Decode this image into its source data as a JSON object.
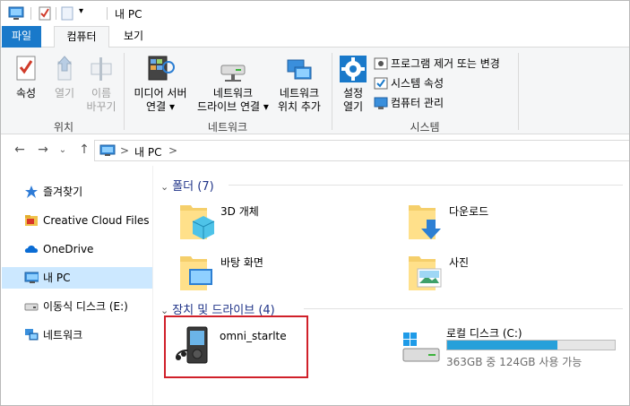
{
  "window": {
    "title": "내 PC"
  },
  "ribbon_tabs": [
    {
      "label": "파일"
    },
    {
      "label": "컴퓨터"
    },
    {
      "label": "보기"
    }
  ],
  "ribbon": {
    "location_group": {
      "label": "위치",
      "properties": "속성",
      "open": "열기",
      "rename_line1": "이름",
      "rename_line2": "바꾸기"
    },
    "network_group": {
      "label": "네트워크",
      "media_line1": "미디어 서버",
      "media_line2": "연결",
      "map_drive_line1": "네트워크",
      "map_drive_line2": "드라이브 연결",
      "add_location_line1": "네트워크",
      "add_location_line2": "위치 추가"
    },
    "system_group": {
      "label": "시스템",
      "settings_line1": "설정",
      "settings_line2": "열기",
      "uninstall": "프로그램 제거 또는 변경",
      "system_properties": "시스템 속성",
      "manage": "컴퓨터 관리"
    }
  },
  "address": {
    "path_root": "내 PC",
    "separator": ">"
  },
  "sidebar": {
    "items": [
      {
        "label": "즐겨찾기"
      },
      {
        "label": "Creative Cloud Files"
      },
      {
        "label": "OneDrive"
      },
      {
        "label": "내 PC"
      },
      {
        "label": "이동식 디스크 (E:)"
      },
      {
        "label": "네트워크"
      }
    ]
  },
  "content": {
    "folders_header": "폴더 (7)",
    "folders": [
      {
        "name": "3D 개체"
      },
      {
        "name": "다운로드"
      },
      {
        "name": "바탕 화면"
      },
      {
        "name": "사진"
      }
    ],
    "drives_header": "장치 및 드라이브 (4)",
    "devices": [
      {
        "name": "omni_starlte"
      }
    ],
    "drives": [
      {
        "name": "로컬 디스크 (C:)",
        "space": "363GB 중 124GB 사용 가능",
        "used_fraction": 0.66
      }
    ]
  },
  "colors": {
    "accent": "#1979ca",
    "selection": "#cce8ff",
    "section_header": "#1e3287",
    "drive_bar": "#26a0da",
    "highlight_border": "#d0202a"
  }
}
